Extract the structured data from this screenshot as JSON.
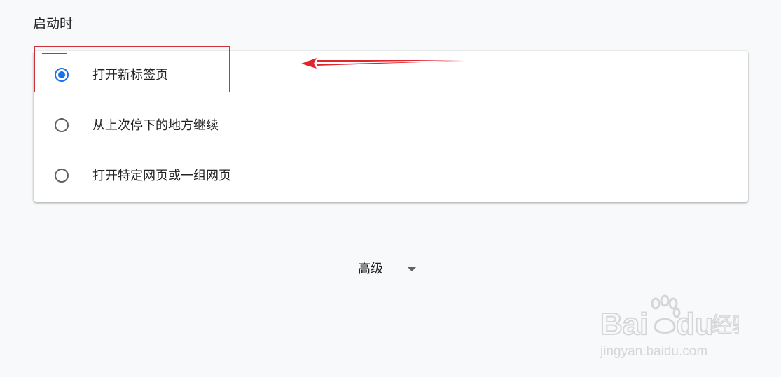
{
  "section": {
    "title": "启动时"
  },
  "startup_options": [
    {
      "label": "打开新标签页",
      "checked": true
    },
    {
      "label": "从上次停下的地方继续",
      "checked": false
    },
    {
      "label": "打开特定网页或一组网页",
      "checked": false
    }
  ],
  "advanced": {
    "label": "高级",
    "icon": "caret-down-icon"
  },
  "watermark": {
    "brand": "Bai du 经验",
    "url": "jingyan.baidu.com"
  },
  "colors": {
    "accent": "#1a73e8",
    "annotation": "#d0303a",
    "background": "#f8f9fa"
  }
}
